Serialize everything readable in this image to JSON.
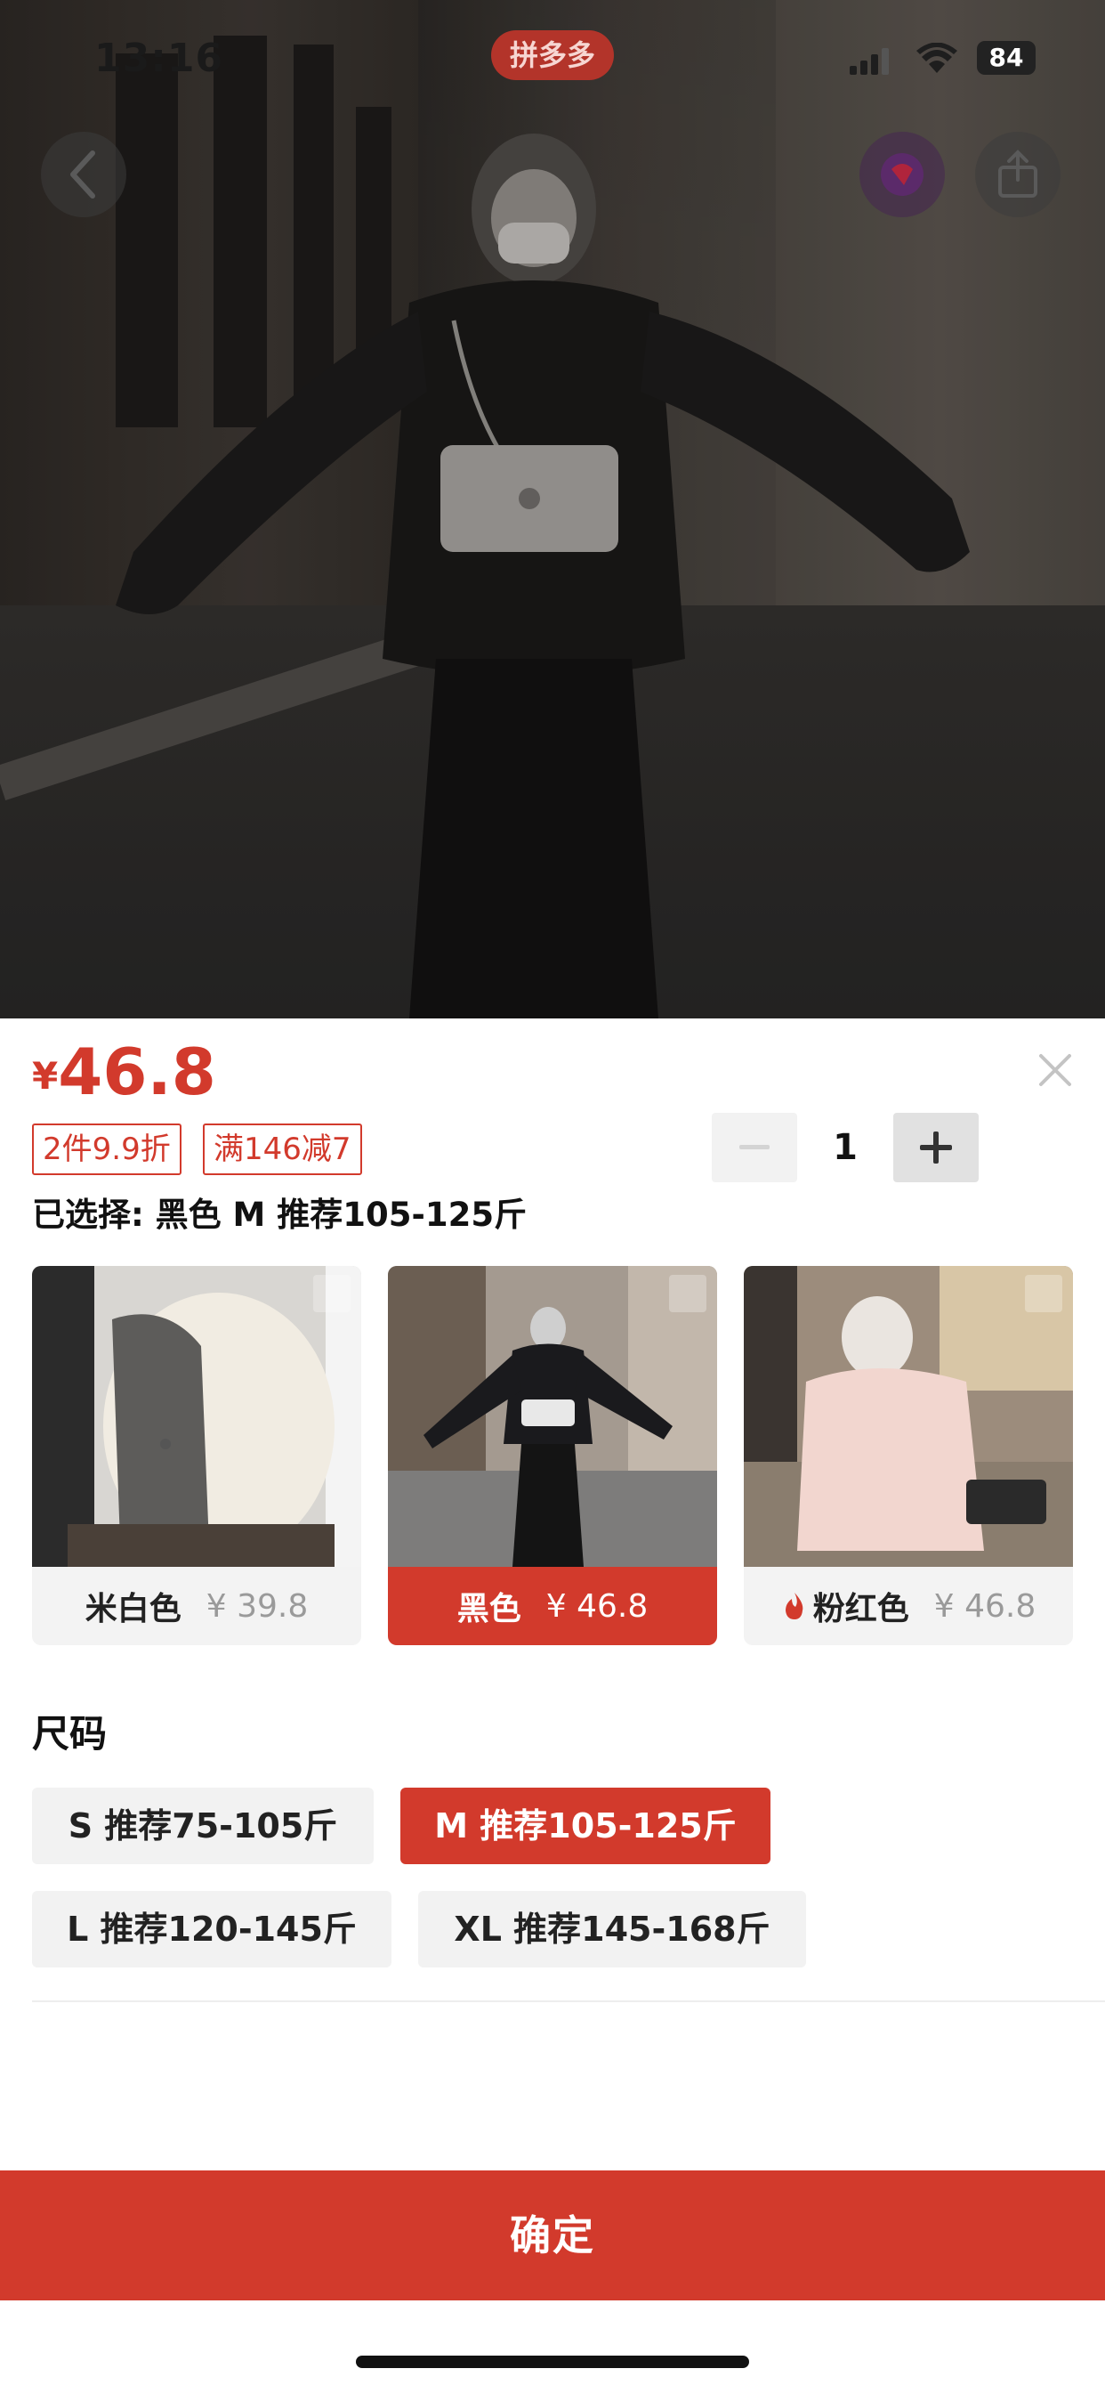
{
  "status_bar": {
    "time": "13:16",
    "app_badge": "拼多多",
    "battery": "84"
  },
  "hero": {
    "back_icon": "chevron-left-icon",
    "avatar_icon": "app-logo-icon",
    "share_icon": "share-icon"
  },
  "sheet": {
    "price_symbol": "¥",
    "price": "46.8",
    "promos": [
      "2件9.9折",
      "满146减7"
    ],
    "quantity": "1",
    "selected": "已选择: 黑色 M 推荐105-125斤",
    "colors": [
      {
        "name": "米白色",
        "price": "¥ 39.8",
        "selected": false,
        "hot": false
      },
      {
        "name": "黑色",
        "price": "¥ 46.8",
        "selected": true,
        "hot": false
      },
      {
        "name": "粉红色",
        "price": "¥ 46.8",
        "selected": false,
        "hot": true
      }
    ],
    "size_title": "尺码",
    "sizes": [
      {
        "label": "S 推荐75-105斤",
        "selected": false
      },
      {
        "label": "M 推荐105-125斤",
        "selected": true
      },
      {
        "label": "L 推荐120-145斤",
        "selected": false
      },
      {
        "label": "XL 推荐145-168斤",
        "selected": false
      }
    ],
    "confirm_label": "确定"
  },
  "colors": {
    "accent": "#d23a2c",
    "chip_bg": "#f2f2f2"
  }
}
